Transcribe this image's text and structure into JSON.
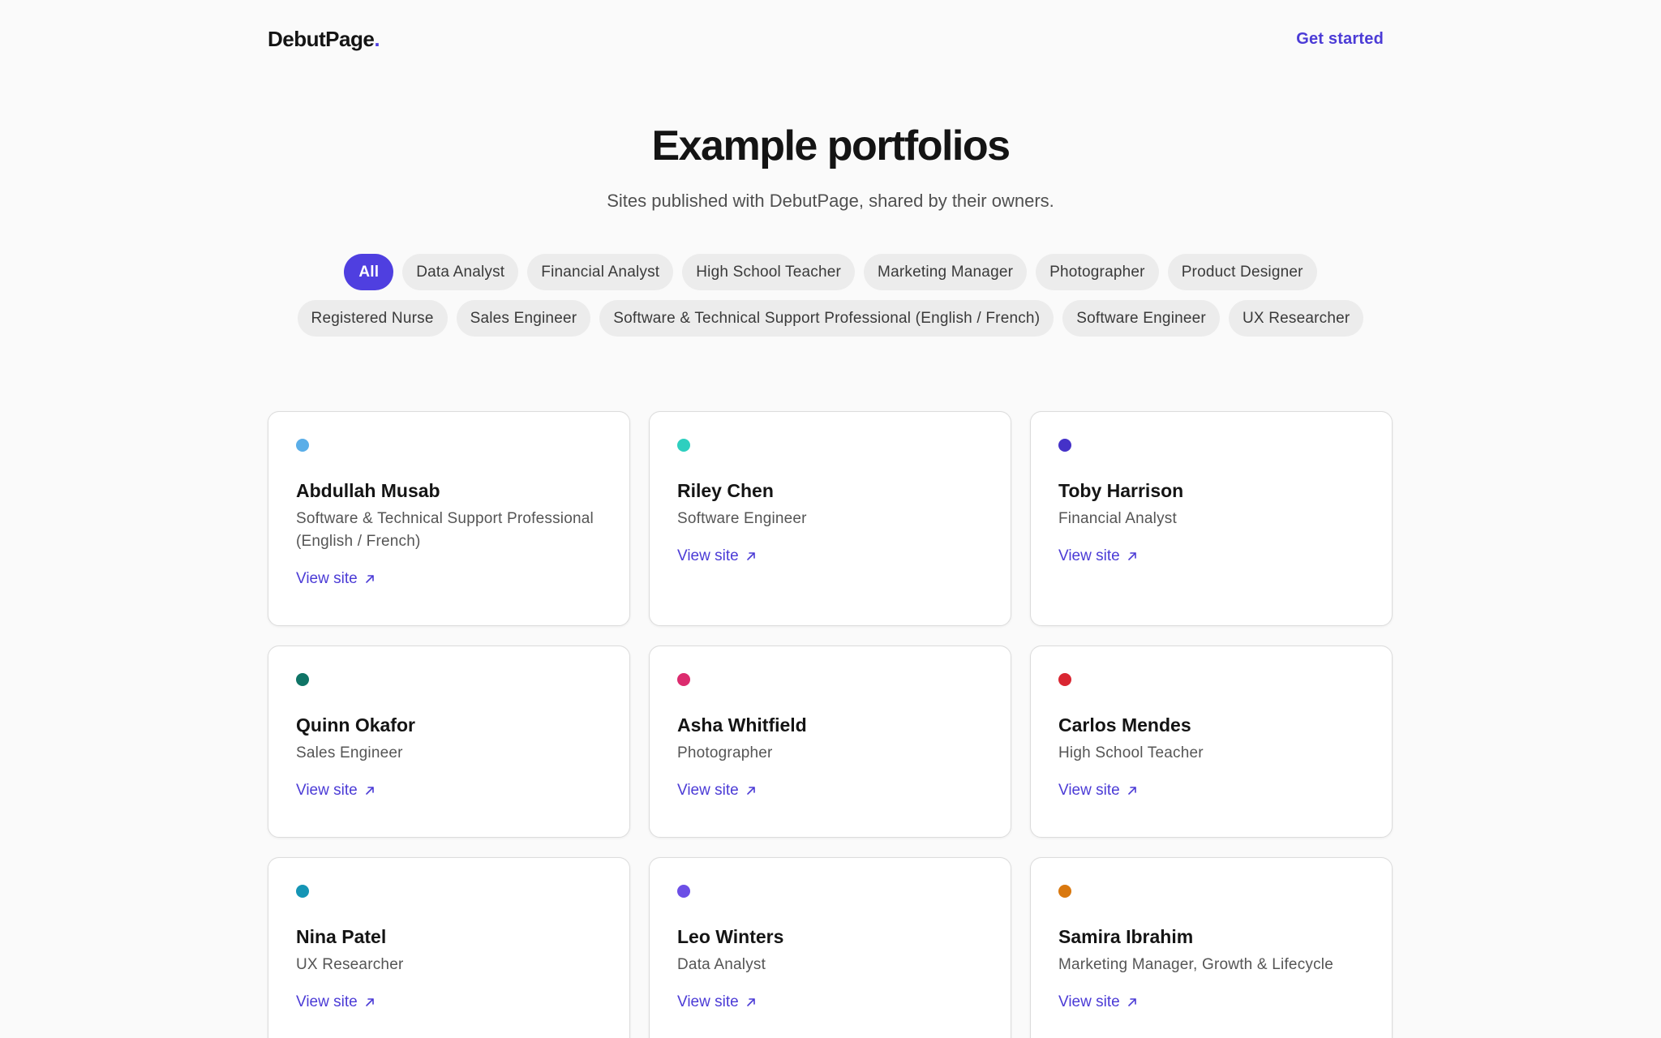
{
  "header": {
    "brand": "DebutPage",
    "brand_dot": ".",
    "cta_label": "Get started"
  },
  "hero": {
    "title": "Example portfolios",
    "subtitle": "Sites published with DebutPage, shared by their owners."
  },
  "filters": [
    {
      "label": "All",
      "active": true
    },
    {
      "label": "Data Analyst",
      "active": false
    },
    {
      "label": "Financial Analyst",
      "active": false
    },
    {
      "label": "High School Teacher",
      "active": false
    },
    {
      "label": "Marketing Manager",
      "active": false
    },
    {
      "label": "Photographer",
      "active": false
    },
    {
      "label": "Product Designer",
      "active": false
    },
    {
      "label": "Registered Nurse",
      "active": false
    },
    {
      "label": "Sales Engineer",
      "active": false
    },
    {
      "label": "Software & Technical Support Professional (English / French)",
      "active": false
    },
    {
      "label": "Software Engineer",
      "active": false
    },
    {
      "label": "UX Researcher",
      "active": false
    }
  ],
  "cards": [
    {
      "name": "Abdullah Musab",
      "role": "Software & Technical Support Professional (English / French)",
      "color": "#5aaee8",
      "link_label": "View site"
    },
    {
      "name": "Riley Chen",
      "role": "Software Engineer",
      "color": "#2ecfbf",
      "link_label": "View site"
    },
    {
      "name": "Toby Harrison",
      "role": "Financial Analyst",
      "color": "#4532c8",
      "link_label": "View site"
    },
    {
      "name": "Quinn Okafor",
      "role": "Sales Engineer",
      "color": "#0f7466",
      "link_label": "View site"
    },
    {
      "name": "Asha Whitfield",
      "role": "Photographer",
      "color": "#dc2b6e",
      "link_label": "View site"
    },
    {
      "name": "Carlos Mendes",
      "role": "High School Teacher",
      "color": "#d92632",
      "link_label": "View site"
    },
    {
      "name": "Nina Patel",
      "role": "UX Researcher",
      "color": "#1595b5",
      "link_label": "View site"
    },
    {
      "name": "Leo Winters",
      "role": "Data Analyst",
      "color": "#6c4fe6",
      "link_label": "View site"
    },
    {
      "name": "Samira Ibrahim",
      "role": "Marketing Manager, Growth & Lifecycle",
      "color": "#d9780f",
      "link_label": "View site"
    }
  ],
  "icons": {
    "card_link_icon": "arrow-up-right-icon",
    "card_marker_icon": "color-dot-icon"
  },
  "colors": {
    "accent": "#4f3fe0",
    "link": "#4b3bd6",
    "chip_bg": "#ececec",
    "page_bg": "#fafafa"
  }
}
